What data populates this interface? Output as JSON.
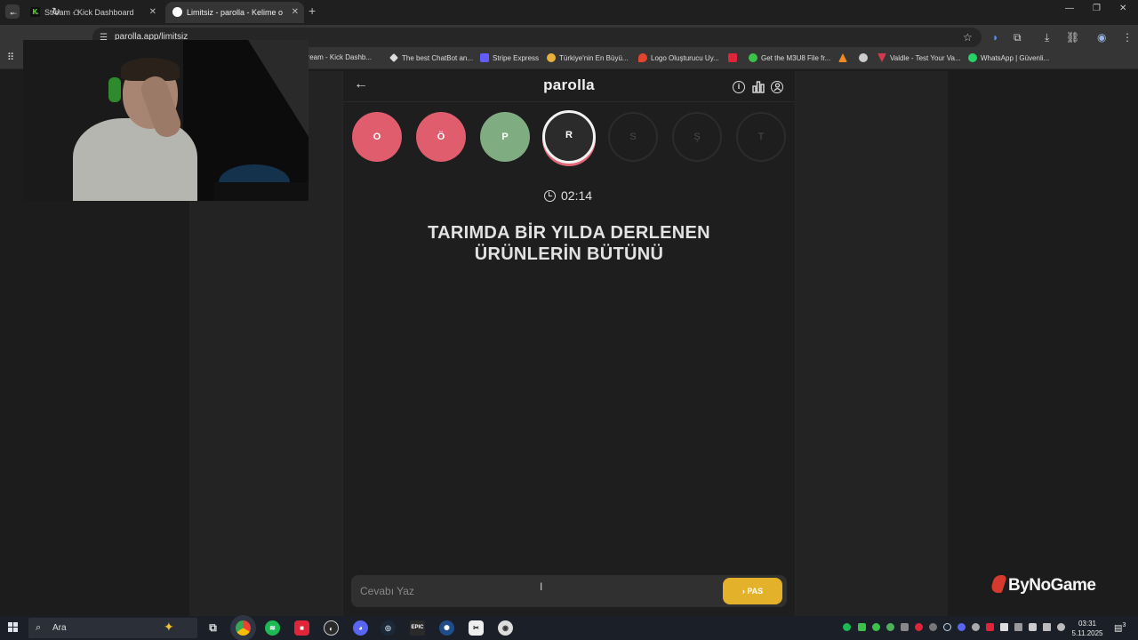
{
  "browser": {
    "tabs": [
      {
        "title": "Stream - Kick Dashboard",
        "favicon": "K",
        "favicon_color": "#53fc18",
        "active": false
      },
      {
        "title": "Limitsiz - parolla - Kelime o",
        "favicon": "",
        "favicon_color": "#ffffff",
        "active": true
      }
    ],
    "url": "parolla.app/limitsiz",
    "bookmarks": [
      {
        "label": "Stream - Kick Dashb...",
        "color": "#53fc18"
      },
      {
        "label": "The best ChatBot an...",
        "color": "#dddddd"
      },
      {
        "label": "Stripe Express",
        "color": "#635bff"
      },
      {
        "label": "Türkiye'nin En Büyü...",
        "color": "#e8b23a"
      },
      {
        "label": "Logo Oluşturucu Uy...",
        "color": "#e2452f"
      },
      {
        "label": "",
        "color": "#e0243a"
      },
      {
        "label": "Get the M3U8 File fr...",
        "color": "#3cc24a"
      },
      {
        "label": "",
        "color": "#f08a24"
      },
      {
        "label": "",
        "color": "#cccccc"
      },
      {
        "label": "Valdle - Test Your Va...",
        "color": "#d13a4c"
      },
      {
        "label": "WhatsApp | Güvenli...",
        "color": "#25d366"
      }
    ]
  },
  "game": {
    "brand": "parolla",
    "letters": [
      {
        "char": "O",
        "state": "wrong"
      },
      {
        "char": "Ö",
        "state": "wrong"
      },
      {
        "char": "P",
        "state": "right"
      },
      {
        "char": "R",
        "state": "current"
      },
      {
        "char": "S",
        "state": "pending"
      },
      {
        "char": "Ş",
        "state": "pending"
      },
      {
        "char": "T",
        "state": "pending"
      }
    ],
    "timer": "02:14",
    "question_line1": "TARIMDA BİR YILDA DERLENEN",
    "question_line2": "ÜRÜNLERİN BÜTÜNÜ",
    "answer_placeholder": "Cevabı Yaz",
    "pass_label": "PAS",
    "pass_chevron": "›"
  },
  "overlay": {
    "sponsor": "ByNoGame"
  },
  "taskbar": {
    "search_text": "Ara",
    "time": "03:31",
    "date": "5.11.2025",
    "notification_count": "3"
  },
  "colors": {
    "wrong": "#df5d6d",
    "right": "#7fac80",
    "pass_button": "#e3b22a"
  }
}
